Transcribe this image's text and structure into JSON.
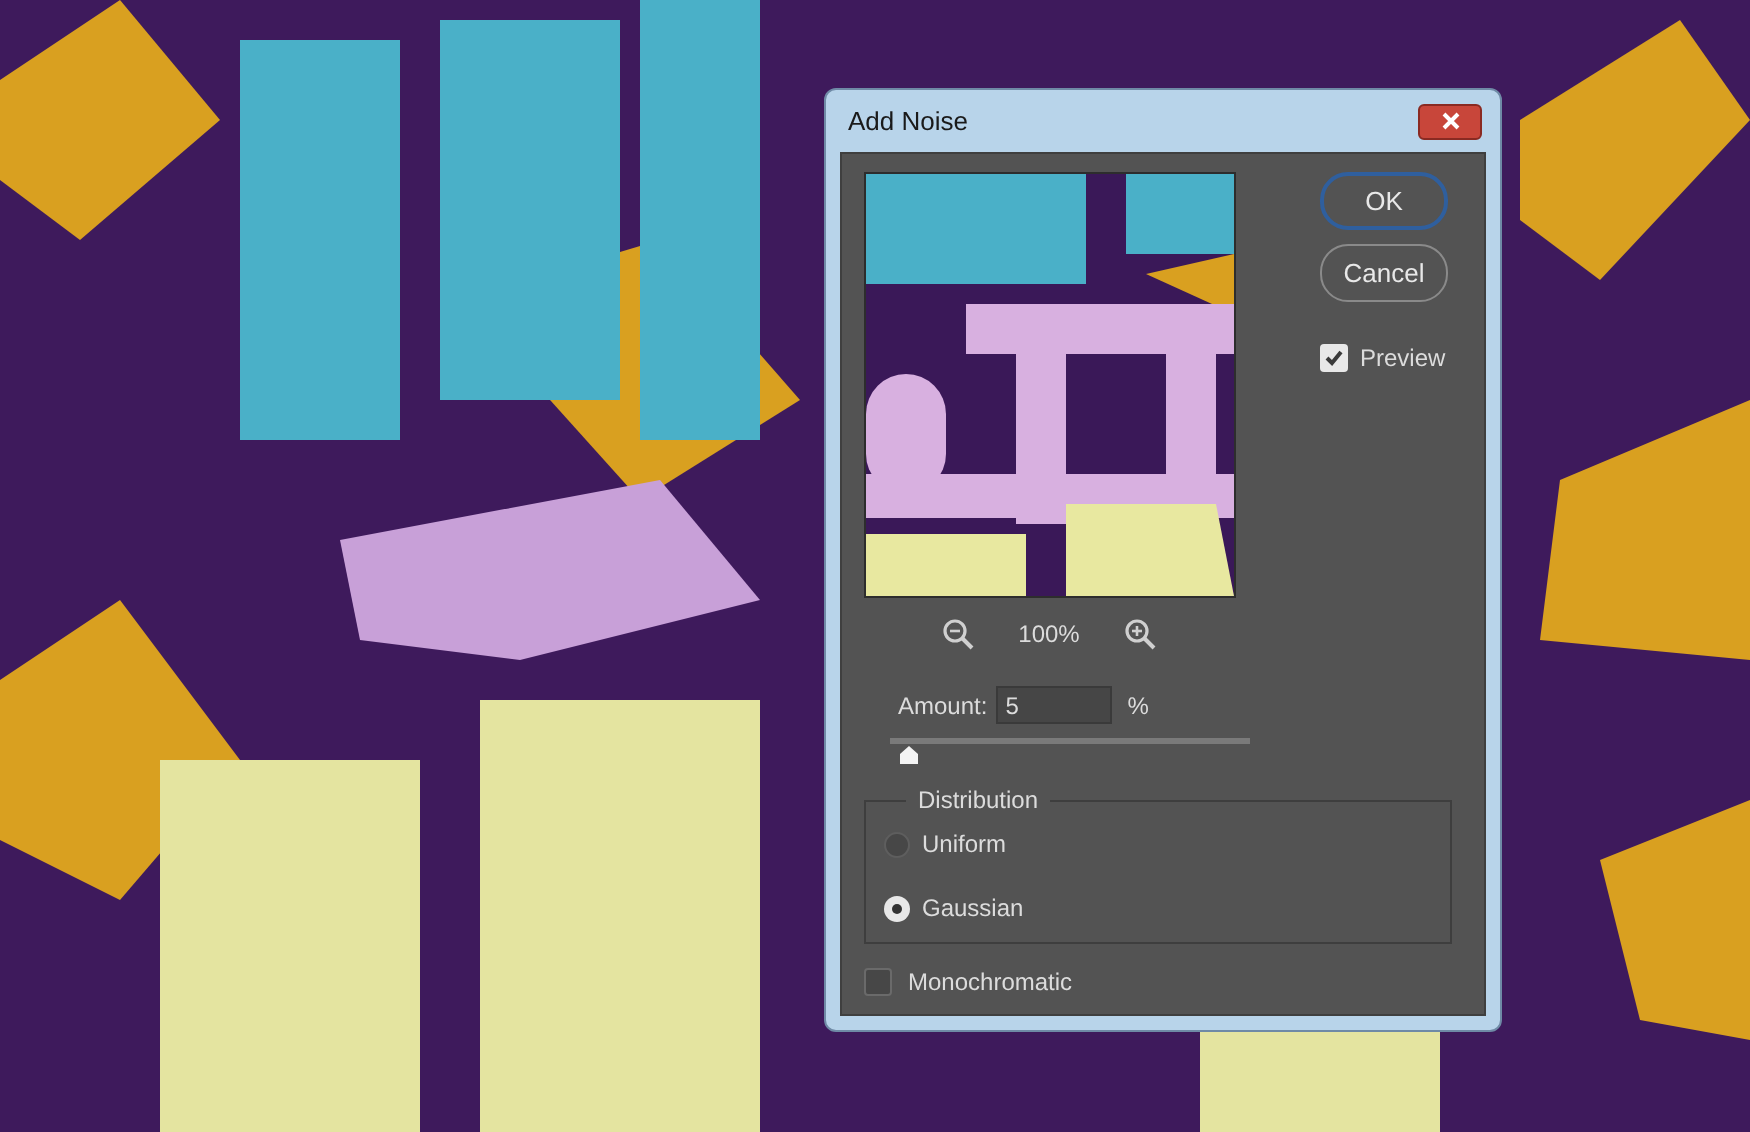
{
  "dialog": {
    "title": "Add Noise",
    "zoom_level": "100%",
    "buttons": [
      {
        "label": "OK",
        "selected": true
      },
      {
        "label": "Cancel",
        "selected": false
      }
    ],
    "preview": {
      "label": "Preview",
      "checked": true
    },
    "amount": {
      "label": "Amount:",
      "value": "5",
      "unit": "%",
      "level": 0.05
    },
    "distribution": {
      "legend": "Distribution",
      "options": [
        {
          "label": "Uniform",
          "selected": false
        },
        {
          "label": "Gaussian",
          "selected": true
        }
      ]
    },
    "monochromatic": {
      "label": "Monochromatic",
      "checked": false
    }
  }
}
